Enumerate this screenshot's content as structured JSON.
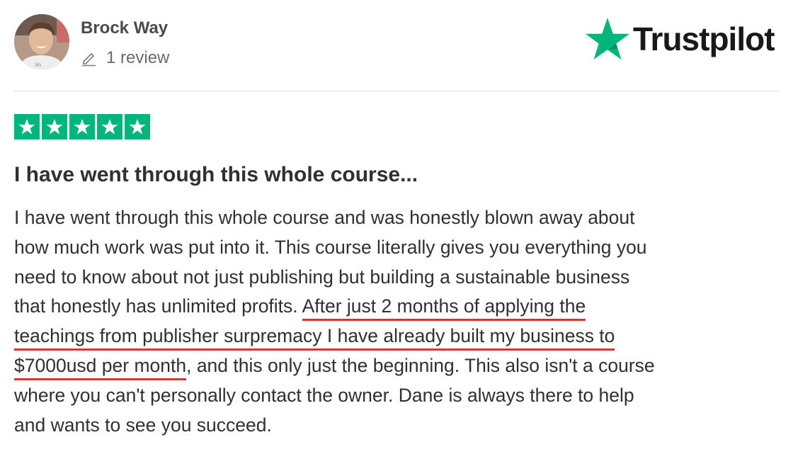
{
  "reviewer": {
    "name": "Brock Way",
    "review_count": "1 review",
    "avatar_icon": "profile-photo"
  },
  "brand": {
    "logo_text": "Trustpilot",
    "logo_icon": "star-icon",
    "logo_star_color": "#00b67a"
  },
  "rating": {
    "stars": 5,
    "max_stars": 5,
    "color": "#00b67a"
  },
  "review": {
    "title": "I have went through this whole course...",
    "lines": [
      {
        "plain_before": "I have went through this whole course and was honestly blown away about",
        "highlight": "",
        "plain_after": ""
      },
      {
        "plain_before": "how much work was put into it. This course literally gives you everything you",
        "highlight": "",
        "plain_after": ""
      },
      {
        "plain_before": "need to know about not just publishing but building a sustainable business",
        "highlight": "",
        "plain_after": ""
      },
      {
        "plain_before": "that honestly has unlimited profits. ",
        "highlight": "After just 2 months of applying the",
        "plain_after": ""
      },
      {
        "plain_before": "",
        "highlight": "teachings from publisher surpremacy I have already built my business to",
        "plain_after": ""
      },
      {
        "plain_before": "",
        "highlight": "$7000usd per month",
        "plain_after": ", and this only just the beginning. This also isn't a course"
      },
      {
        "plain_before": "where you can't personally contact the owner. Dane is always there to help",
        "highlight": "",
        "plain_after": ""
      },
      {
        "plain_before": "and wants to see you succeed.",
        "highlight": "",
        "plain_after": ""
      }
    ],
    "highlight_underline_color": "#d9332b"
  }
}
